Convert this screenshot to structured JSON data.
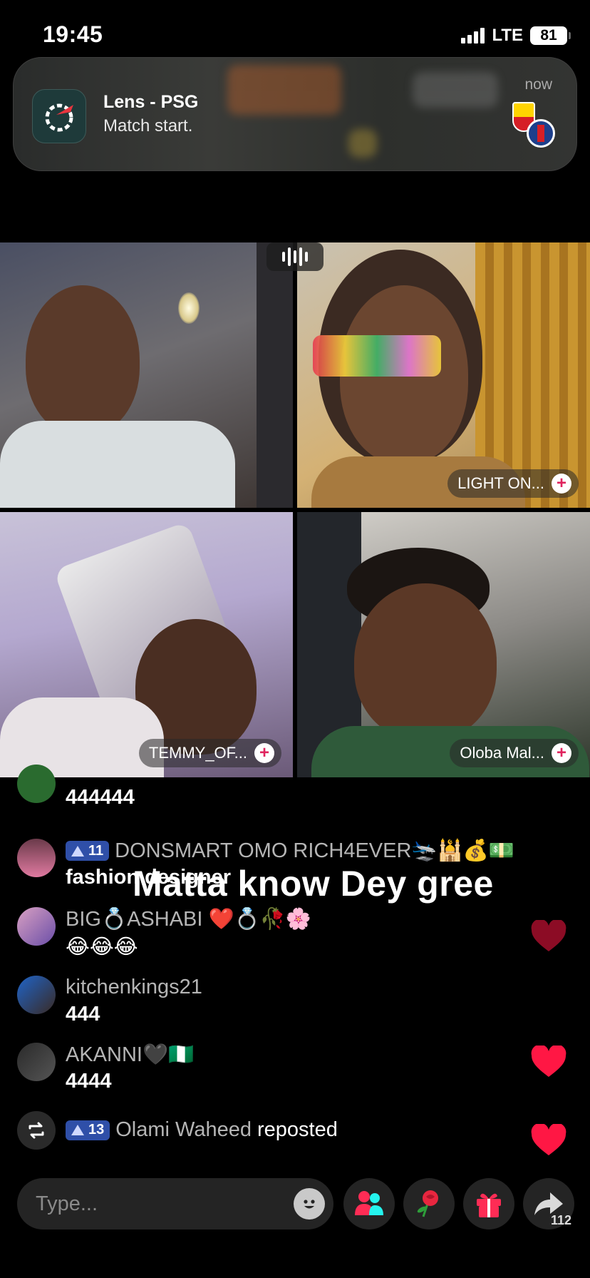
{
  "status_bar": {
    "time": "19:45",
    "network": "LTE",
    "battery": "81"
  },
  "notification": {
    "app_title": "Lens - PSG",
    "body": "Match start.",
    "time": "now",
    "icon": "sports-app-icon",
    "team_crests": [
      "Lens",
      "Paris Saint-Germain"
    ]
  },
  "video_grid": {
    "participants": [
      {
        "label": ""
      },
      {
        "label": "LIGHT ON..."
      },
      {
        "label": "TEMMY_OF..."
      },
      {
        "label": "Oloba Mal..."
      }
    ]
  },
  "chat": {
    "messages": [
      {
        "user": "",
        "text": "444444"
      },
      {
        "level": "11",
        "user": "DONSMART OMO RICH4EVER🛬🕌💰💵",
        "text": "fashion designer"
      },
      {
        "user": "BIG💍ASHABI ❤️💍🥀🌸",
        "text": "😂😂😂"
      },
      {
        "user": "kitchenkings21",
        "text": "444"
      },
      {
        "user": "AKANNI🖤🇳🇬",
        "text": "4444"
      },
      {
        "level": "13",
        "user": "Olami Waheed",
        "action": "reposted"
      }
    ],
    "overlay_caption": "Matta know Dey gree"
  },
  "bottom_bar": {
    "input_placeholder": "Type...",
    "share_count": "112"
  },
  "colors": {
    "accent": "#e0245e",
    "heart": "#ff1744",
    "badge": "#2f4fa8"
  }
}
